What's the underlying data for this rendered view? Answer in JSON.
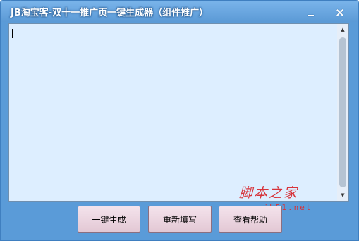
{
  "window": {
    "title": "JB淘宝客-双十一推广页一键生成器（组件推广）"
  },
  "editor": {
    "value": "",
    "placeholder": ""
  },
  "buttons": {
    "generate": "一键生成",
    "refill": "重新填写",
    "help": "查看帮助"
  },
  "watermark": {
    "brand": "脚本之家",
    "url": "www.jb51.net"
  },
  "icons": {
    "minimize": "minimize-icon",
    "close": "close-icon",
    "scroll_up": "scroll-up-arrow-icon",
    "scroll_down": "scroll-down-arrow-icon"
  },
  "colors": {
    "frame": "#5a9bd8",
    "editor_bg": "#ddeeff",
    "button_bg": "#eed8e2",
    "watermark": "#d7333a"
  }
}
